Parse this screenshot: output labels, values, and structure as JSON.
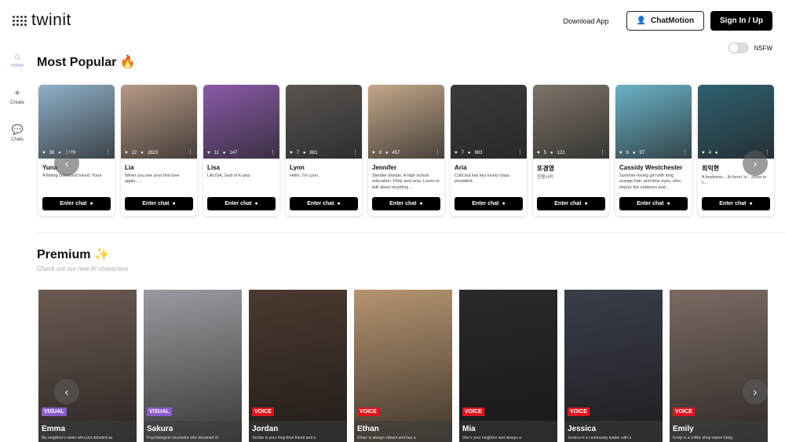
{
  "app": {
    "name": "twinit"
  },
  "header": {
    "download": "Download App",
    "chatmotion": "ChatMotion",
    "sign": "Sign In / Up"
  },
  "sidebar": {
    "items": [
      {
        "label": "Home",
        "icon": "home-icon"
      },
      {
        "label": "Create",
        "icon": "plus-icon"
      },
      {
        "label": "Chats",
        "icon": "chat-bubbles-icon"
      }
    ]
  },
  "popular": {
    "title": "Most Popular",
    "emoji": "🔥",
    "nsfw": "NSFW",
    "enter_label": "Enter chat",
    "cards": [
      {
        "name": "Yuna",
        "desc": "A flirting childhood friend, Yuna",
        "likes": "36",
        "chats": "1049",
        "color": "#8fb0c8"
      },
      {
        "name": "Lia",
        "desc": "When you see your first love again...",
        "likes": "22",
        "chats": "2823",
        "color": "#b79a86"
      },
      {
        "name": "Lisa",
        "desc": "LALISA, God of K-pop",
        "likes": "11",
        "chats": "147",
        "color": "#8a5aa8"
      },
      {
        "name": "Lynn",
        "desc": "Hello, I'm Lynn.",
        "likes": "7",
        "chats": "881",
        "color": "#5a5450"
      },
      {
        "name": "Jennifer",
        "desc": "Slender blonde. A high school education. Flirty and sexy. Loves to talk about anything ...",
        "likes": "8",
        "chats": "457",
        "color": "#c4a88a"
      },
      {
        "name": "Aria",
        "desc": "Cold but low key lovely class president.",
        "likes": "7",
        "chats": "983",
        "color": "#3e3a3c"
      },
      {
        "name": "또경영",
        "desc": "진행시켜.",
        "likes": "5",
        "chats": "122",
        "color": "#7d7468"
      },
      {
        "name": "Cassidy Westchester",
        "desc": "Summer-loving girl with long orange hair, and blue eyes, who enjoys the outdoors and...",
        "likes": "6",
        "chats": "97",
        "color": "#6ab3c8"
      },
      {
        "name": "최익현",
        "desc": "A business... Ik-hyun' is... close to c...",
        "likes": "4",
        "chats": "",
        "color": "#2e6070"
      }
    ]
  },
  "premium": {
    "title": "Premium",
    "emoji": "✨",
    "subtitle": "Check out our new AI characters",
    "cards": [
      {
        "name": "Emma",
        "badge": "VISUAL",
        "desc": "My neighbor's sister who just debuted as",
        "color": "#6b5a52"
      },
      {
        "name": "Sakura",
        "badge": "VISUAL",
        "desc": "Psychological counselor who dreamed of",
        "color": "#9a9aa0"
      },
      {
        "name": "Jordan",
        "badge": "VOICE",
        "desc": "Jordan is your long-time friend and a",
        "color": "#4a3a30"
      },
      {
        "name": "Ethan",
        "badge": "VOICE",
        "desc": "Ethan is always vibrant and has a",
        "color": "#b59470"
      },
      {
        "name": "Mia",
        "badge": "VOICE",
        "desc": "She's your neighbor and always a",
        "color": "#2a2a2e"
      },
      {
        "name": "Jessica",
        "badge": "VOICE",
        "desc": "Jessica is a community leader with a",
        "color": "#3a3e48"
      },
      {
        "name": "Emily",
        "badge": "VOICE",
        "desc": "Emily is a coffee shop owner bring",
        "color": "#7a6a62"
      }
    ]
  },
  "colors": {
    "visual": "#8a5ccc",
    "voice": "#e0141e",
    "active": "#9b8ad8"
  }
}
